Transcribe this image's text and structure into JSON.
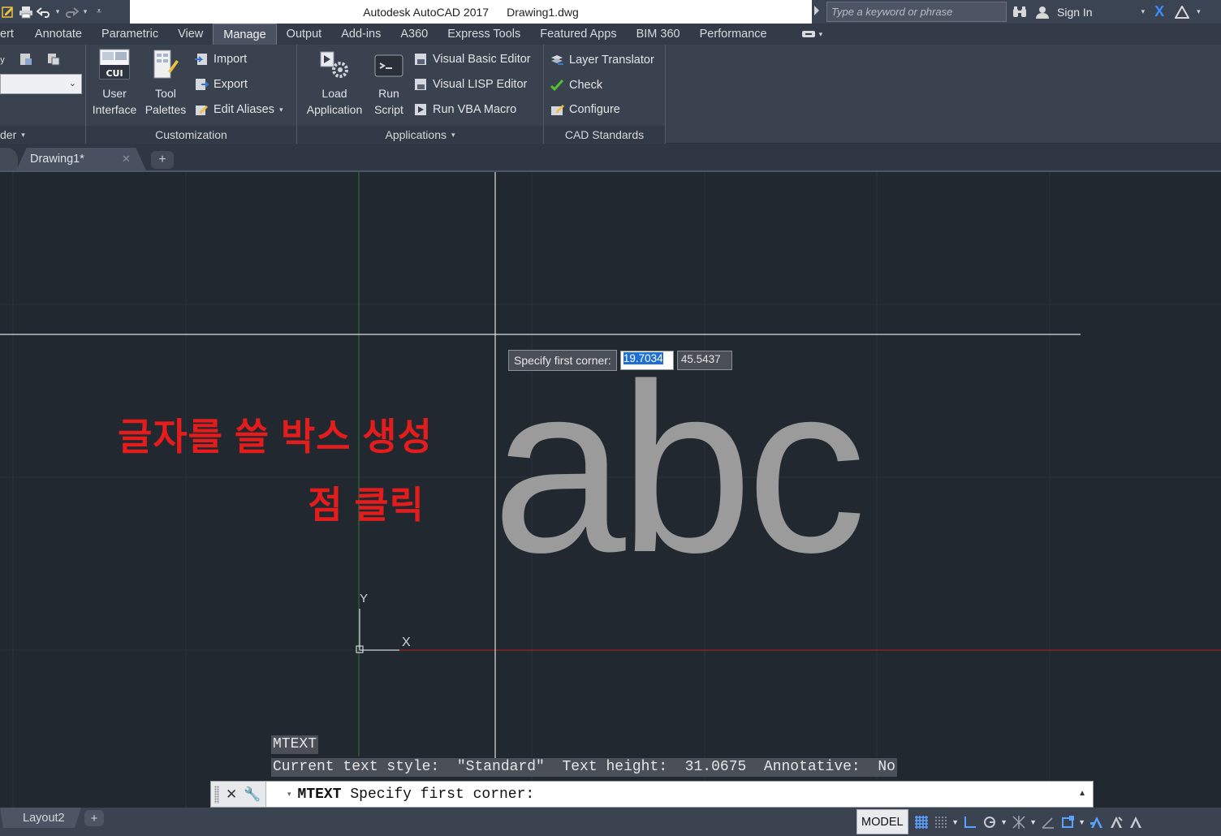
{
  "titlebar": {
    "app_title": "Autodesk AutoCAD 2017",
    "file_name": "Drawing1.dwg",
    "search_placeholder": "Type a keyword or phrase",
    "sign_in": "Sign In"
  },
  "ribbon_tabs": [
    {
      "label": "ert"
    },
    {
      "label": "Annotate"
    },
    {
      "label": "Parametric"
    },
    {
      "label": "View"
    },
    {
      "label": "Manage",
      "active": true
    },
    {
      "label": "Output"
    },
    {
      "label": "Add-ins"
    },
    {
      "label": "A360"
    },
    {
      "label": "Express Tools"
    },
    {
      "label": "Featured Apps"
    },
    {
      "label": "BIM 360"
    },
    {
      "label": "Performance"
    }
  ],
  "ribbon": {
    "partial_panel_title": "der",
    "customization": {
      "title": "Customization",
      "user_interface": {
        "line1": "User",
        "line2": "Interface",
        "icon_text": "CUI"
      },
      "tool_palettes": {
        "line1": "Tool",
        "line2": "Palettes"
      },
      "import": "Import",
      "export": "Export",
      "edit_aliases": "Edit Aliases"
    },
    "applications": {
      "title": "Applications",
      "load_application": {
        "line1": "Load",
        "line2": "Application"
      },
      "run_script": {
        "line1": "Run",
        "line2": "Script"
      },
      "visual_basic_editor": "Visual Basic Editor",
      "visual_lisp_editor": "Visual LISP Editor",
      "run_vba_macro": "Run VBA Macro"
    },
    "cad_standards": {
      "title": "CAD Standards",
      "layer_translator": "Layer Translator",
      "check": "Check",
      "configure": "Configure"
    }
  },
  "doc_tab": {
    "label": "Drawing1*"
  },
  "canvas": {
    "tooltip_label": "Specify first corner:",
    "coord_x": "19.7034",
    "coord_y": "45.5437",
    "drawn_text": "abc",
    "annotation_line1": "글자를 쓸 박스 생성",
    "annotation_line2": "점 클릭",
    "ucs_x": "X",
    "ucs_y": "Y"
  },
  "command": {
    "history_1": "MTEXT",
    "history_2": "Current text style:  \"Standard\"  Text height:  31.0675  Annotative:  No",
    "current_command": "MTEXT",
    "current_prompt": "Specify first corner:"
  },
  "statusbar": {
    "layout_tab": "Layout2",
    "model": "MODEL"
  },
  "colors": {
    "canvas_bg": "#212830",
    "annotation_red": "#e31c1c",
    "drawn_text_gray": "#9b9b9b",
    "x_axis_red": "#b02020",
    "y_axis_green": "#2e7a32"
  },
  "icons": [
    "save-icon",
    "print-icon",
    "undo-icon",
    "redo-icon",
    "binoculars-icon",
    "user-icon",
    "exchange-icon",
    "a360-icon",
    "cui-icon",
    "palette-icon",
    "gear-icon",
    "script-icon",
    "check-icon",
    "grid-icon",
    "snap-icon",
    "ortho-icon",
    "polar-icon",
    "osnap-icon",
    "annotation-scale-icon"
  ]
}
